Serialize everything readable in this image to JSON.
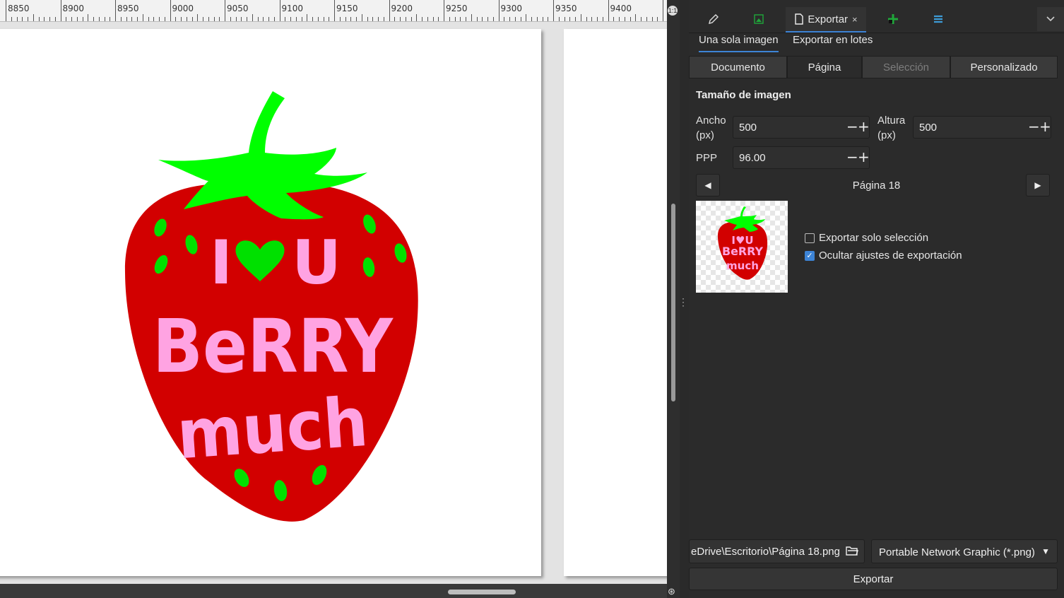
{
  "ruler": {
    "labels": [
      "8850",
      "8900",
      "8950",
      "9000",
      "9050",
      "9100",
      "9150",
      "9200",
      "9250",
      "9300",
      "9350",
      "9400"
    ]
  },
  "artwork": {
    "line1": "I",
    "line1b": "U",
    "line2": "BeRRY",
    "line3": "much",
    "colors": {
      "berry": "#d20000",
      "leaf": "#00ff00",
      "text": "#ffa3e2",
      "seed": "#00e000"
    }
  },
  "corner": {
    "badge": "1:1"
  },
  "panel": {
    "dock_tabs": [
      {
        "icon": "pen-icon",
        "label": ""
      },
      {
        "icon": "image-icon",
        "label": ""
      },
      {
        "icon": "document-export-icon",
        "label": "Exportar"
      },
      {
        "icon": "node-icon",
        "label": ""
      },
      {
        "icon": "layers-icon",
        "label": ""
      }
    ],
    "close": "×",
    "subtabs": [
      "Una sola imagen",
      "Exportar en lotes"
    ],
    "area_options": [
      "Documento",
      "Página",
      "Selección",
      "Personalizado"
    ],
    "section_title": "Tamaño de imagen",
    "width_label": "Ancho\n(px)",
    "width_label_1": "Ancho",
    "width_label_2": "(px)",
    "width_value": "500",
    "height_label_1": "Altura",
    "height_label_2": "(px)",
    "height_value": "500",
    "dpi_label": "PPP",
    "dpi_value": "96.00",
    "page_label": "Página 18",
    "checkbox_selection_only": "Exportar solo selección",
    "checkbox_selection_only_checked": false,
    "checkbox_hide_settings": "Ocultar ajustes de exportación",
    "checkbox_hide_settings_checked": true,
    "file_path": "eDrive\\Escritorio\\Página 18.png",
    "format": "Portable Network Graphic (*.png)",
    "export_button": "Exportar"
  }
}
